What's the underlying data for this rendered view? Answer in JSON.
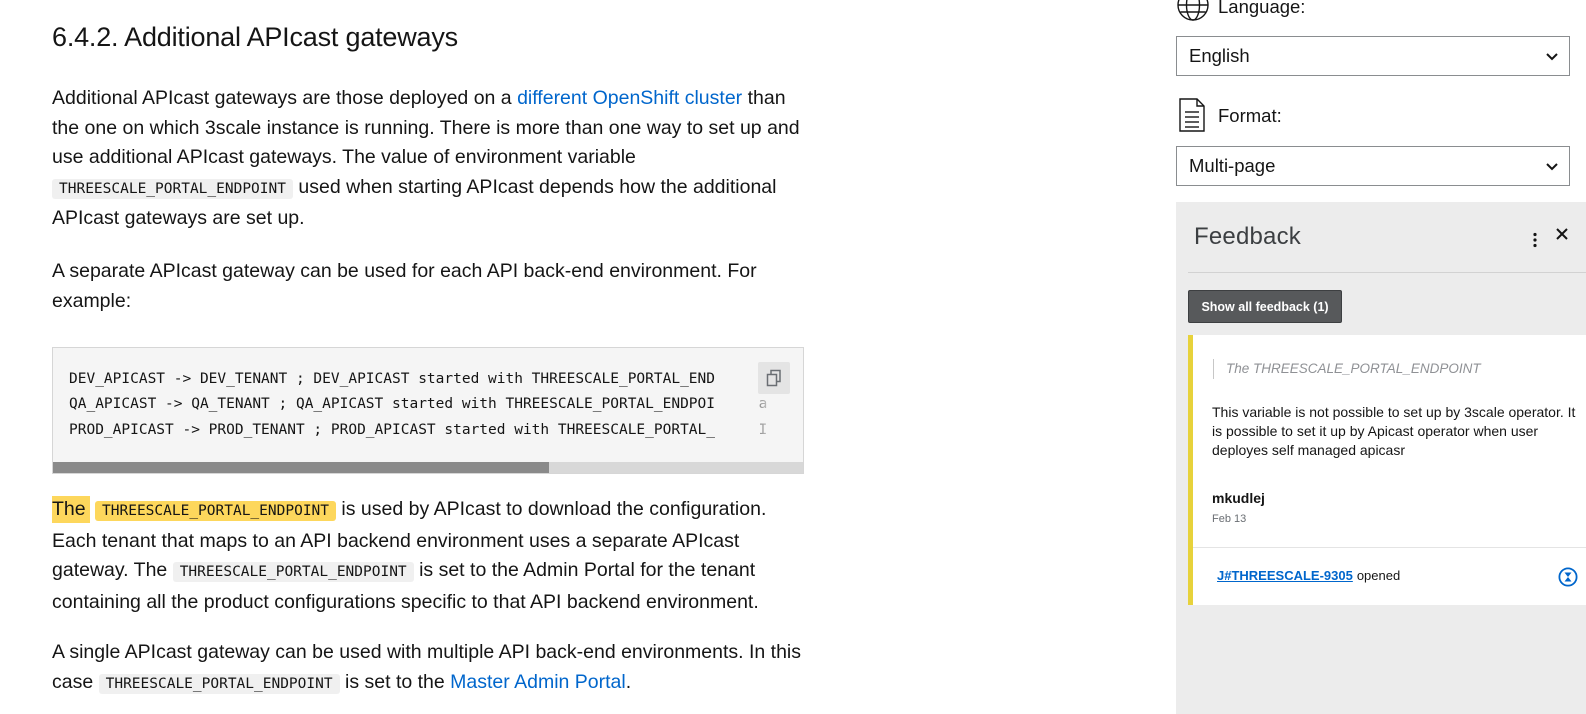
{
  "doc": {
    "heading": "6.4.2. Additional APIcast gateways",
    "p1": {
      "t1": "Additional APIcast gateways are those deployed on a ",
      "link": "different OpenShift cluster",
      "t2": " than the one on which 3scale instance is running. There is more than one way to set up and use additional APIcast gateways. The value of environment variable ",
      "code": "THREESCALE_PORTAL_ENDPOINT",
      "t3": " used when starting APIcast depends how the additional APIcast gateways are set up."
    },
    "p2": "A separate APIcast gateway can be used for each API back-end environment. For example:",
    "code_lines": [
      "DEV_APICAST -> DEV_TENANT ; DEV_APICAST started with THREESCALE_PORTAL_END",
      "QA_APICAST -> QA_TENANT ; QA_APICAST started with THREESCALE_PORTAL_ENDPOI     a",
      "PROD_APICAST -> PROD_TENANT ; PROD_APICAST started with THREESCALE_PORTAL_     I"
    ],
    "p3": {
      "hl_word": "The",
      "hl_code": "THREESCALE_PORTAL_ENDPOINT",
      "t1": " is used by APIcast to download the configuration. Each tenant that maps to an API backend environment uses a separate APIcast gateway. The ",
      "code": "THREESCALE_PORTAL_ENDPOINT",
      "t2": " is set to the Admin Portal for the tenant containing all the product configurations specific to that API backend environment."
    },
    "p4": {
      "t1": "A single APIcast gateway can be used with multiple API back-end environments. In this case ",
      "code": "THREESCALE_PORTAL_ENDPOINT",
      "t2": " is set to the ",
      "link": "Master Admin Portal",
      "t3": "."
    },
    "scroll_fraction": 0.66
  },
  "rail": {
    "language_label": "Language:",
    "language_value": "English",
    "format_label": "Format:",
    "format_value": "Multi-page"
  },
  "feedback": {
    "title": "Feedback",
    "show_all": "Show all feedback (1)",
    "quote": "The THREESCALE_PORTAL_ENDPOINT",
    "body": "This variable is not possible to set up by 3scale operator. It is possible to set it up by Apicast operator when user deployes self managed apicasr",
    "user": "mkudlej",
    "date": "Feb 13",
    "jira_link": "J#THREESCALE-9305",
    "jira_status": "opened"
  },
  "colors": {
    "link": "#0066cc",
    "highlight": "#fdd75c",
    "card_accent": "#e7d23b"
  }
}
